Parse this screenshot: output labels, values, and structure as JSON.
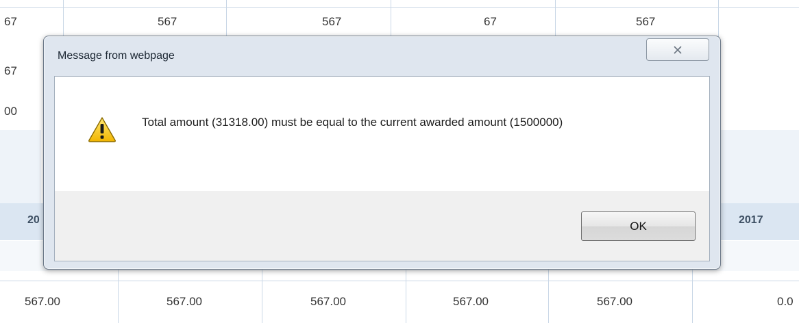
{
  "background": {
    "top_row": [
      "67",
      "567",
      "567",
      "67",
      "567"
    ],
    "left_col": [
      "67",
      "00"
    ],
    "year_left": "20",
    "year_right": "2017",
    "bottom_row": [
      "567.00",
      "567.00",
      "567.00",
      "567.00",
      "567.00",
      "0.0"
    ]
  },
  "dialog": {
    "title": "Message from webpage",
    "close_icon": "close-icon",
    "warning_icon": "warning-icon",
    "message": "Total amount (31318.00) must be equal to the current awarded amount (1500000)",
    "ok_label": "OK"
  }
}
